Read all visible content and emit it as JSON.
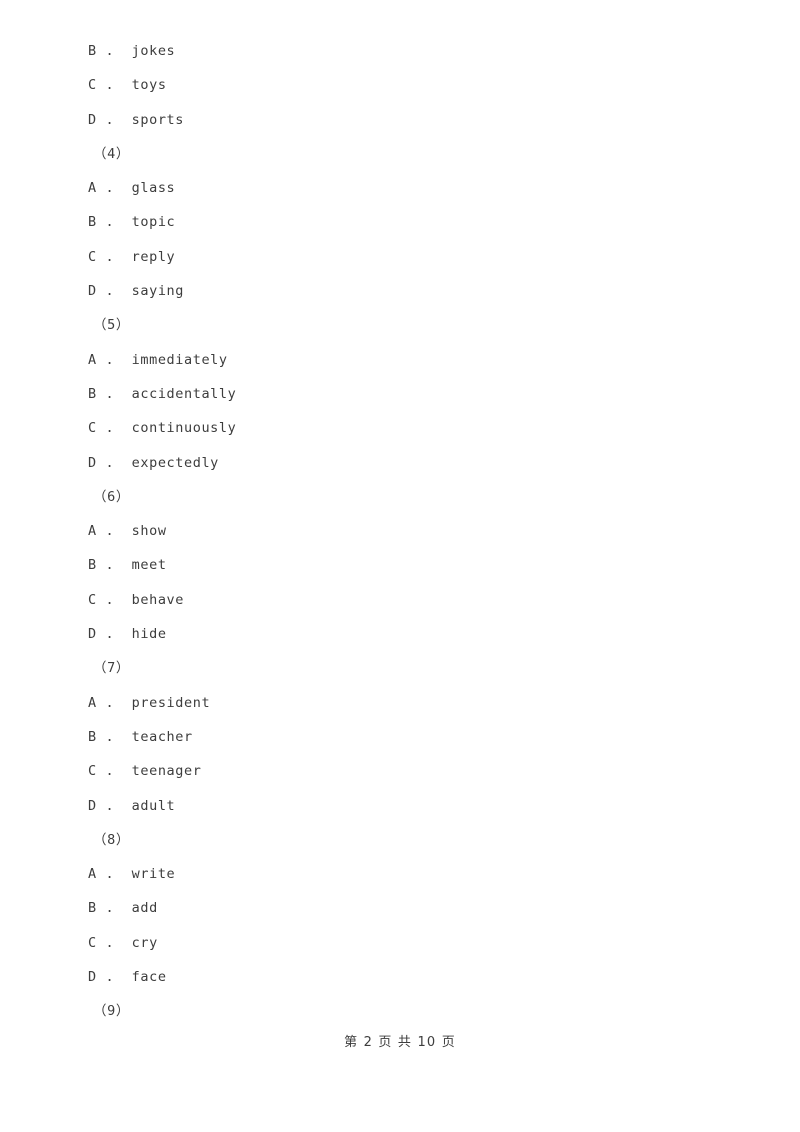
{
  "document": {
    "page_background": "#ffffff",
    "text_color": "#3d3d3d"
  },
  "lines": [
    {
      "kind": "option",
      "letter": "B",
      "separator": ".",
      "text": "jokes",
      "full": "B .  jokes"
    },
    {
      "kind": "option",
      "letter": "C",
      "separator": ".",
      "text": "toys",
      "full": "C .  toys"
    },
    {
      "kind": "option",
      "letter": "D",
      "separator": ".",
      "text": "sports",
      "full": "D .  sports"
    },
    {
      "kind": "question",
      "number": "（4）",
      "full": "（4）"
    },
    {
      "kind": "option",
      "letter": "A",
      "separator": ".",
      "text": "glass",
      "full": "A .  glass"
    },
    {
      "kind": "option",
      "letter": "B",
      "separator": ".",
      "text": "topic",
      "full": "B .  topic"
    },
    {
      "kind": "option",
      "letter": "C",
      "separator": ".",
      "text": "reply",
      "full": "C .  reply"
    },
    {
      "kind": "option",
      "letter": "D",
      "separator": ".",
      "text": "saying",
      "full": "D .  saying"
    },
    {
      "kind": "question",
      "number": "（5）",
      "full": "（5）"
    },
    {
      "kind": "option",
      "letter": "A",
      "separator": ".",
      "text": "immediately",
      "full": "A .  immediately"
    },
    {
      "kind": "option",
      "letter": "B",
      "separator": ".",
      "text": "accidentally",
      "full": "B .  accidentally"
    },
    {
      "kind": "option",
      "letter": "C",
      "separator": ".",
      "text": "continuously",
      "full": "C .  continuously"
    },
    {
      "kind": "option",
      "letter": "D",
      "separator": ".",
      "text": "expectedly",
      "full": "D .  expectedly"
    },
    {
      "kind": "question",
      "number": "（6）",
      "full": "（6）"
    },
    {
      "kind": "option",
      "letter": "A",
      "separator": ".",
      "text": "show",
      "full": "A .  show"
    },
    {
      "kind": "option",
      "letter": "B",
      "separator": ".",
      "text": "meet",
      "full": "B .  meet"
    },
    {
      "kind": "option",
      "letter": "C",
      "separator": ".",
      "text": "behave",
      "full": "C .  behave"
    },
    {
      "kind": "option",
      "letter": "D",
      "separator": ".",
      "text": "hide",
      "full": "D .  hide"
    },
    {
      "kind": "question",
      "number": "（7）",
      "full": "（7）"
    },
    {
      "kind": "option",
      "letter": "A",
      "separator": ".",
      "text": "president",
      "full": "A .  president"
    },
    {
      "kind": "option",
      "letter": "B",
      "separator": ".",
      "text": "teacher",
      "full": "B .  teacher"
    },
    {
      "kind": "option",
      "letter": "C",
      "separator": ".",
      "text": "teenager",
      "full": "C .  teenager"
    },
    {
      "kind": "option",
      "letter": "D",
      "separator": ".",
      "text": "adult",
      "full": "D .  adult"
    },
    {
      "kind": "question",
      "number": "（8）",
      "full": "（8）"
    },
    {
      "kind": "option",
      "letter": "A",
      "separator": ".",
      "text": "write",
      "full": "A .  write"
    },
    {
      "kind": "option",
      "letter": "B",
      "separator": ".",
      "text": "add",
      "full": "B .  add"
    },
    {
      "kind": "option",
      "letter": "C",
      "separator": ".",
      "text": "cry",
      "full": "C .  cry"
    },
    {
      "kind": "option",
      "letter": "D",
      "separator": ".",
      "text": "face",
      "full": "D .  face"
    },
    {
      "kind": "question",
      "number": "（9）",
      "full": "（9）"
    }
  ],
  "footer": {
    "text": "第 2 页 共 10 页",
    "current_page": "2",
    "total_pages": "10"
  }
}
